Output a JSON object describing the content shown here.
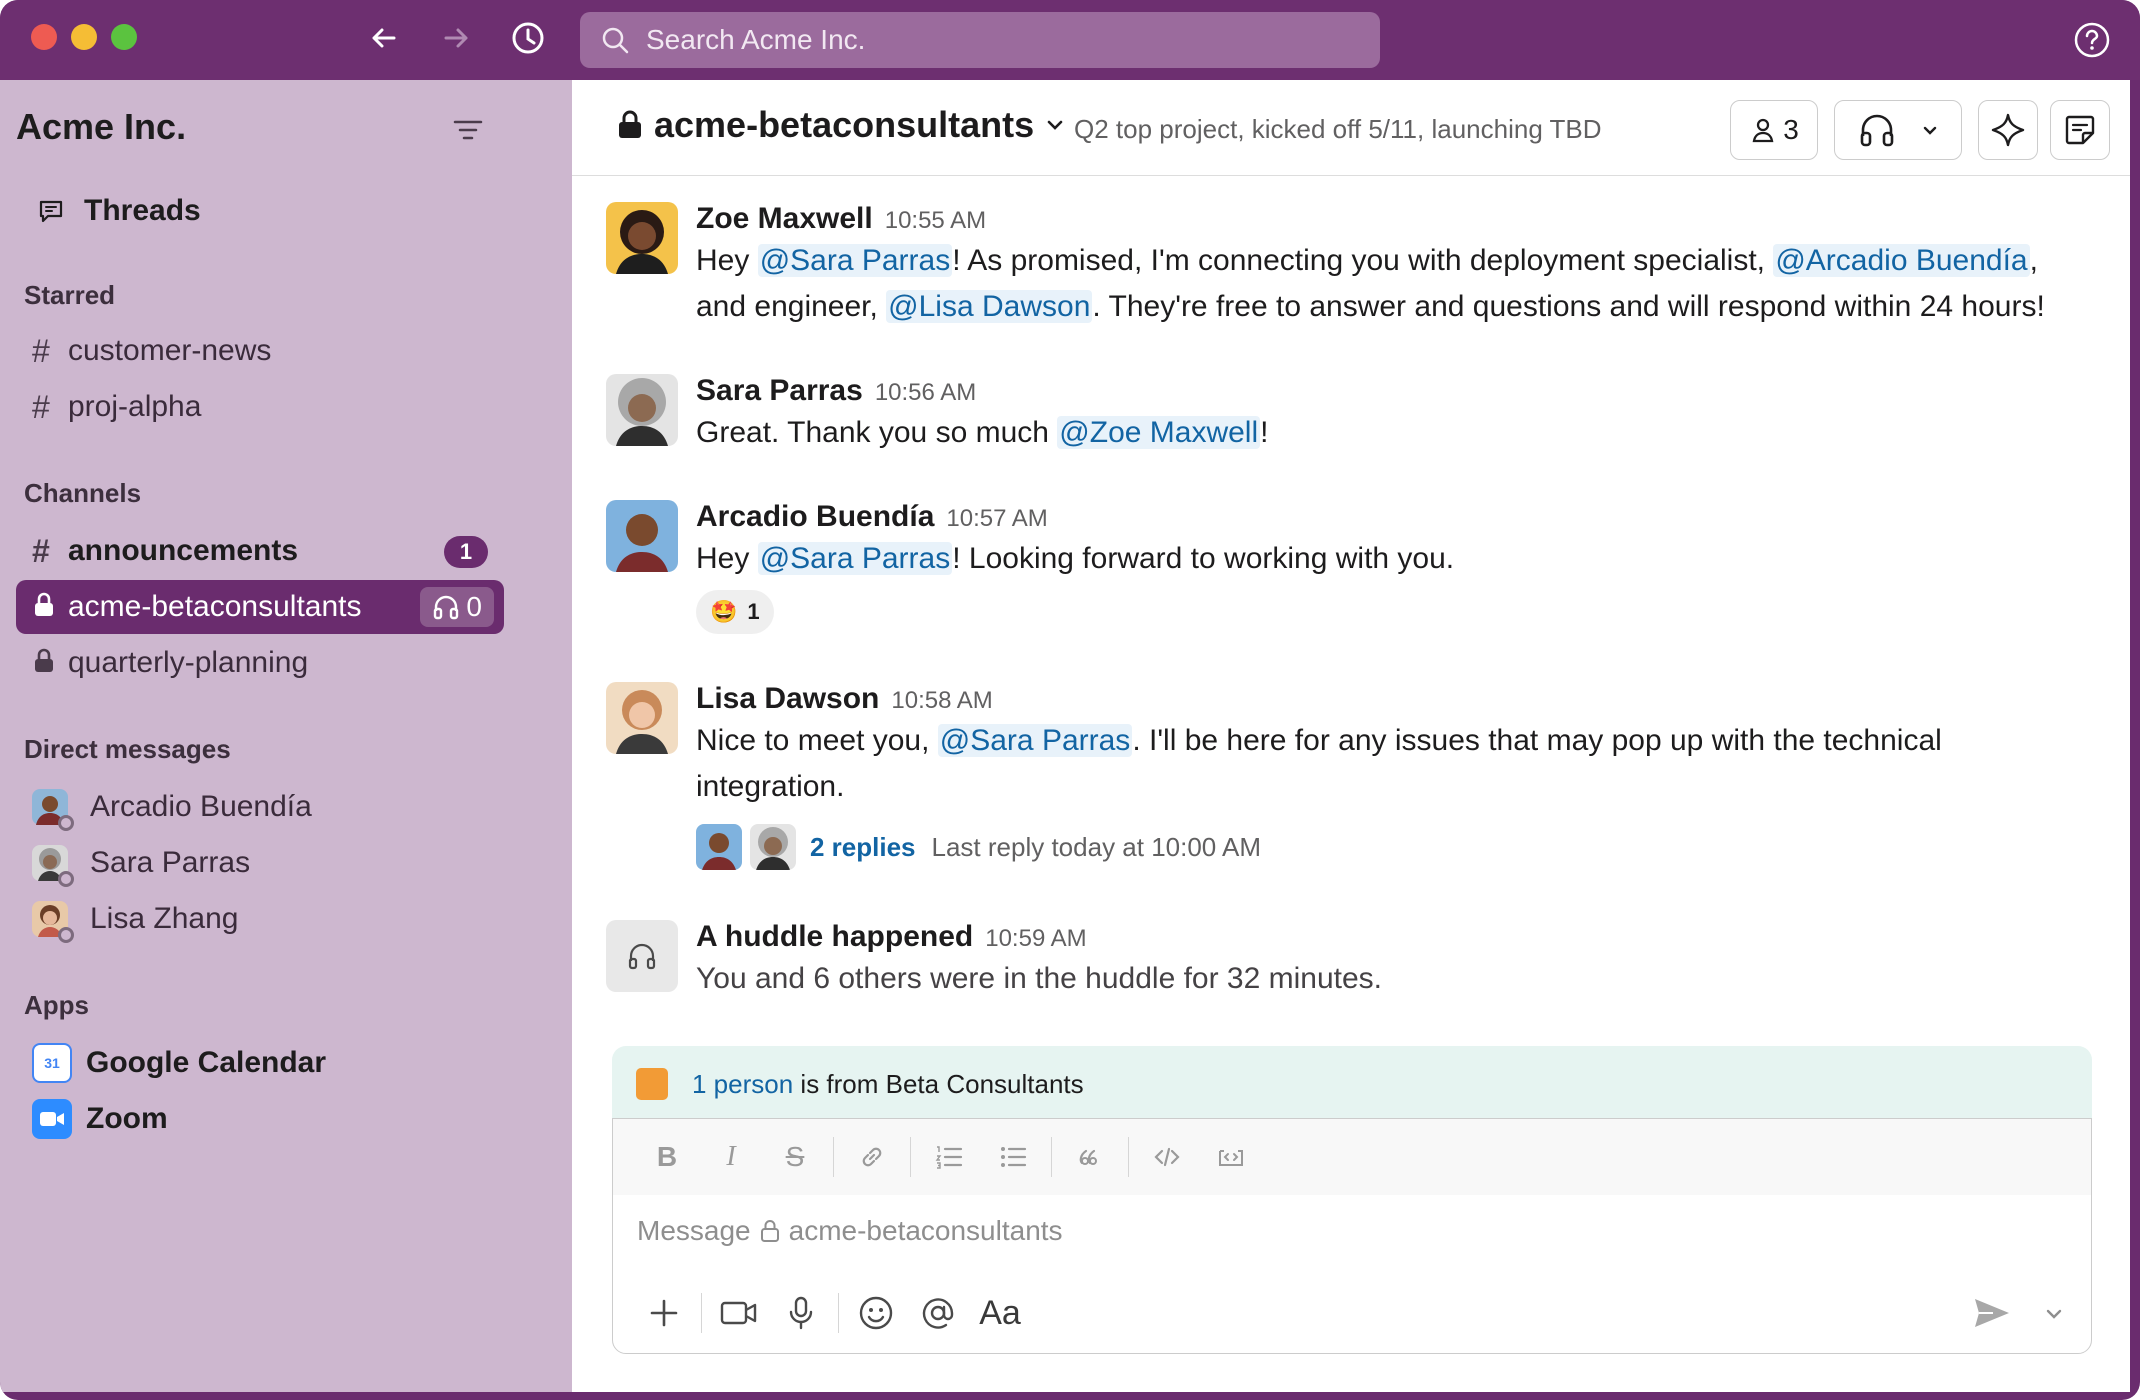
{
  "titlebar": {
    "search_placeholder": "Search Acme Inc."
  },
  "sidebar": {
    "workspace": "Acme Inc.",
    "threads_label": "Threads",
    "starred_label": "Starred",
    "starred": [
      {
        "name": "customer-news"
      },
      {
        "name": "proj-alpha"
      }
    ],
    "channels_label": "Channels",
    "channels": [
      {
        "name": "announcements",
        "badge": "1"
      },
      {
        "name": "acme-betaconsultants",
        "huddle_count": "0"
      },
      {
        "name": "quarterly-planning"
      }
    ],
    "dms_label": "Direct messages",
    "dms": [
      {
        "name": "Arcadio Buendía"
      },
      {
        "name": "Sara Parras"
      },
      {
        "name": "Lisa Zhang"
      }
    ],
    "apps_label": "Apps",
    "apps": [
      {
        "name": "Google Calendar",
        "icon": "calendar-icon",
        "badge_text": "31"
      },
      {
        "name": "Zoom",
        "icon": "zoom-icon"
      }
    ]
  },
  "channel": {
    "name": "acme-betaconsultants",
    "topic": "Q2 top project, kicked off 5/11, launching TBD",
    "member_count": "3"
  },
  "messages": [
    {
      "author": "Zoe Maxwell",
      "time": "10:55 AM",
      "parts": [
        "Hey ",
        "@Sara Parras",
        "! As promised, I'm connecting you with deployment specialist, ",
        "@Arcadio Buendía",
        ",",
        "and engineer, ",
        "@Lisa Dawson",
        ". They're free to answer and questions and will respond within 24 hours!"
      ]
    },
    {
      "author": "Sara Parras",
      "time": "10:56 AM",
      "parts": [
        "Great. Thank you so much ",
        "@Zoe Maxwell",
        "!"
      ]
    },
    {
      "author": "Arcadio Buendía",
      "time": "10:57 AM",
      "parts": [
        "Hey ",
        "@Sara Parras",
        "! Looking forward to working with you."
      ],
      "reaction": {
        "emoji": "🤩",
        "count": "1"
      }
    },
    {
      "author": "Lisa Dawson",
      "time": "10:58 AM",
      "parts": [
        "Nice to meet you, ",
        "@Sara Parras",
        ". I'll be here for any issues that may pop up with the technical",
        "integration."
      ],
      "thread": {
        "replies": "2 replies",
        "last_reply": "Last reply today at 10:00 AM"
      }
    },
    {
      "author": "A huddle happened",
      "time": "10:59 AM",
      "text": "You and 6 others were in the huddle for 32 minutes."
    }
  ],
  "external_banner": {
    "link": "1 person",
    "rest": " is from Beta Consultants"
  },
  "composer": {
    "placeholder_prefix": "Message",
    "placeholder_channel": "acme-betaconsultants",
    "text_format_label": "Aa"
  },
  "colors": {
    "aubergine": "#6a2c6e",
    "sidebar": "#cdb7cf",
    "mention_bg": "#e8f2fa",
    "mention_text": "#1264a3",
    "external_swatch": "#f29b36"
  }
}
